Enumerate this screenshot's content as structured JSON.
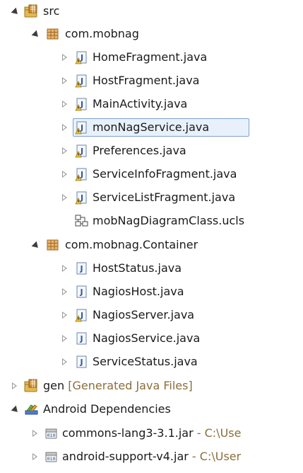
{
  "colors": {
    "accent": "#7da2ce",
    "selection_bg": "#e8f1fb",
    "decoration": "#8a6f3a"
  },
  "tree": {
    "src": "src",
    "pkg1": "com.mobnag",
    "files1": [
      "HomeFragment.java",
      "HostFragment.java",
      "MainActivity.java",
      "monNagService.java",
      "Preferences.java",
      "ServiceInfoFragment.java",
      "ServiceListFragment.java"
    ],
    "diagram": "mobNagDiagramClass.ucls",
    "pkg2": "com.mobnag.Container",
    "files2": [
      "HostStatus.java",
      "NagiosHost.java",
      "NagiosServer.java",
      "NagiosService.java",
      "ServiceStatus.java"
    ],
    "gen": "gen",
    "gen_decor": "[Generated Java Files]",
    "android_deps": "Android Dependencies",
    "jars": [
      {
        "name": "commons-lang3-3.1.jar",
        "sep": " - ",
        "path": "C:\\Use"
      },
      {
        "name": "android-support-v4.jar",
        "sep": " - ",
        "path": "C:\\User"
      }
    ],
    "icons": {
      "src": "source-folder-icon",
      "pkg": "package-icon",
      "java_warn": "java-file-warning-icon",
      "java": "java-file-icon",
      "ucls": "class-diagram-icon",
      "lib": "library-icon",
      "jar": "jar-file-icon"
    }
  }
}
